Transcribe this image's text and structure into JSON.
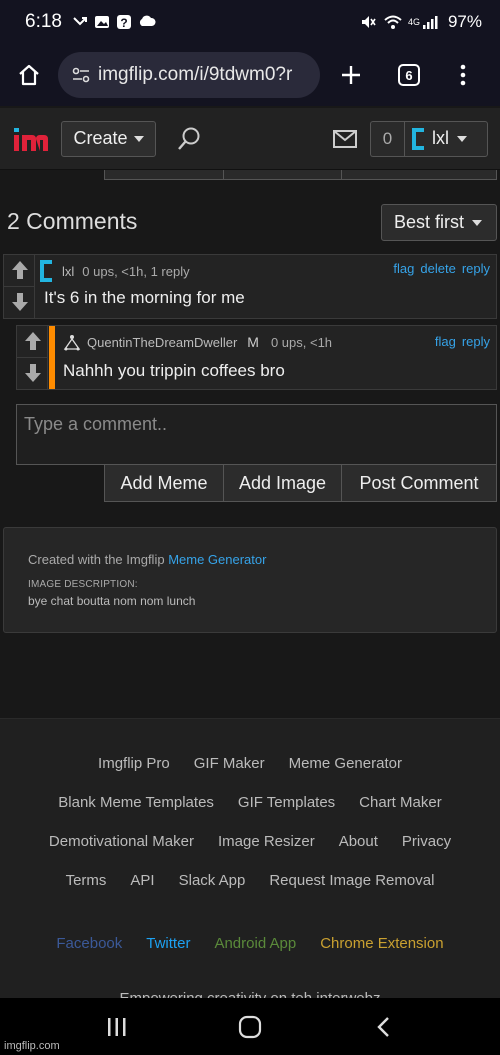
{
  "status": {
    "time": "6:18",
    "battery": "97%",
    "network": "4G"
  },
  "browser": {
    "url": "imgflip.com/i/9tdwm0?r",
    "tab_count": "6"
  },
  "header": {
    "create_label": "Create",
    "notif_count": "0",
    "username": "lxl"
  },
  "comments_section": {
    "count_label": "2 Comments",
    "sort_label": "Best first",
    "comments": [
      {
        "user": "lxl",
        "meta": "0 ups, <1h, 1 reply",
        "text": "It's 6 in the morning for me",
        "links": [
          "flag",
          "delete",
          "reply"
        ]
      },
      {
        "user": "QuentinTheDreamDweller",
        "badge": "M",
        "meta": "0 ups, <1h",
        "text": "Nahhh you trippin coffees bro",
        "links": [
          "flag",
          "reply"
        ]
      }
    ],
    "input_placeholder": "Type a comment..",
    "actions": [
      "Add Meme",
      "Add Image",
      "Post Comment"
    ]
  },
  "description": {
    "created_prefix": "Created with the Imgflip ",
    "created_link": "Meme Generator",
    "label": "IMAGE DESCRIPTION:",
    "text": "bye chat boutta nom nom lunch"
  },
  "footer": {
    "row1": [
      "Imgflip Pro",
      "GIF Maker",
      "Meme Generator"
    ],
    "row2": [
      "Blank Meme Templates",
      "GIF Templates",
      "Chart Maker"
    ],
    "row3": [
      "Demotivational Maker",
      "Image Resizer",
      "About",
      "Privacy"
    ],
    "row4": [
      "Terms",
      "API",
      "Slack App",
      "Request Image Removal"
    ],
    "social": [
      {
        "label": "Facebook",
        "color": "#3b5998"
      },
      {
        "label": "Twitter",
        "color": "#1da1f2"
      },
      {
        "label": "Android App",
        "color": "#5a8a3a"
      },
      {
        "label": "Chrome Extension",
        "color": "#c9a030"
      }
    ],
    "tagline": "Empowering creativity on teh interwebz"
  },
  "watermark": "imgflip.com",
  "colors": {
    "accent_link": "#36a3e8",
    "mod_bar": "#ff8c00",
    "logo_red": "#e0223a",
    "logo_cyan": "#22b5e0"
  }
}
